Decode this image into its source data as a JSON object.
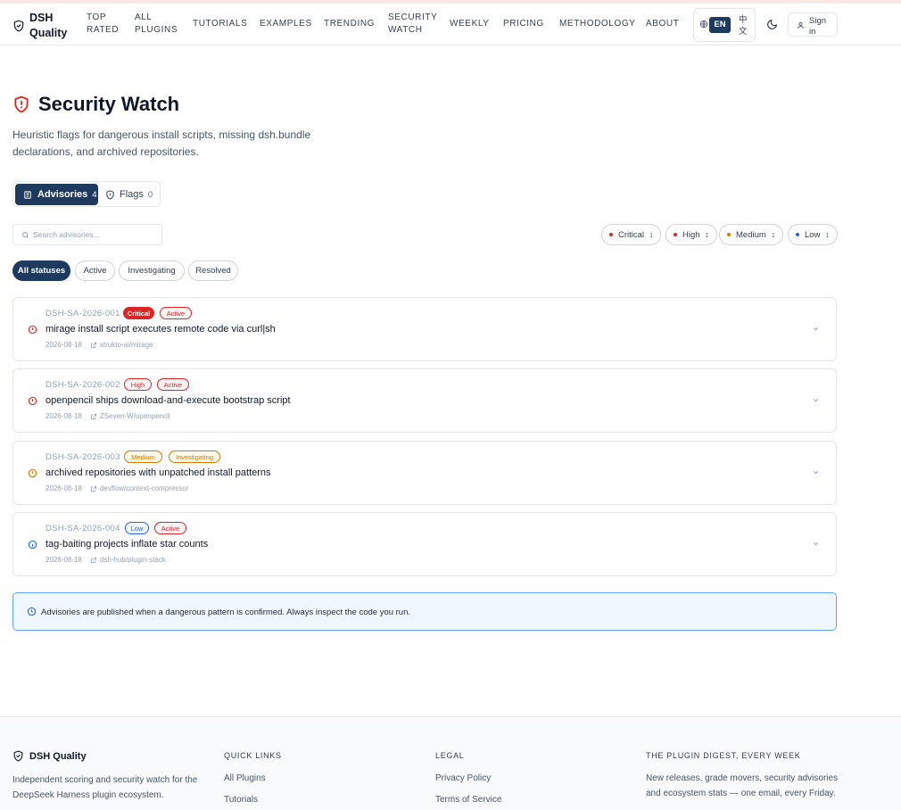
{
  "header": {
    "brand": "DSH Quality",
    "nav": [
      "TOP RATED",
      "ALL PLUGINS",
      "TUTORIALS",
      "EXAMPLES",
      "TRENDING",
      "SECURITY WATCH",
      "WEEKLY",
      "PRICING",
      "METHODOLOGY",
      "ABOUT"
    ],
    "lang_en": "EN",
    "lang_zh": "中文",
    "signin": "Sign in"
  },
  "page": {
    "title": "Security Watch",
    "subtitle": "Heuristic flags for dangerous install scripts, missing dsh.bundle declarations, and archived repositories."
  },
  "tabs": {
    "advisories_label": "Advisories",
    "advisories_count": "4",
    "flags_label": "Flags",
    "flags_count": "0"
  },
  "search": {
    "placeholder": "Search advisories..."
  },
  "severity_filters": [
    {
      "label": "Critical",
      "count": "1",
      "color": "#dc2626"
    },
    {
      "label": "High",
      "count": "1",
      "color": "#dc2626"
    },
    {
      "label": "Medium",
      "count": "1",
      "color": "#d97706"
    },
    {
      "label": "Low",
      "count": "1",
      "color": "#2563eb"
    }
  ],
  "status_filters": [
    "All statuses",
    "Active",
    "Investigating",
    "Resolved"
  ],
  "advisories": [
    {
      "id": "DSH-SA-2026-001",
      "severity": "Critical",
      "status": "Active",
      "title": "mirage install script executes remote code via curl|sh",
      "date": "2026-08-18",
      "repo": "strukto-ai/mirage"
    },
    {
      "id": "DSH-SA-2026-002",
      "severity": "High",
      "status": "Active",
      "title": "openpencil ships download-and-execute bootstrap script",
      "date": "2026-08-18",
      "repo": "ZSeven-W/openpencil"
    },
    {
      "id": "DSH-SA-2026-003",
      "severity": "Medium",
      "status": "Investigating",
      "title": "archived repositories with unpatched install patterns",
      "date": "2026-08-18",
      "repo": "devflow/context-compressor"
    },
    {
      "id": "DSH-SA-2026-004",
      "severity": "Low",
      "status": "Active",
      "title": "tag-baiting projects inflate star counts",
      "date": "2026-08-18",
      "repo": "dsh-hub/plugin-stack"
    }
  ],
  "notice": "Advisories are published when a dangerous pattern is confirmed. Always inspect the code you run.",
  "footer": {
    "brand": "DSH Quality",
    "desc": "Independent scoring and security watch for the DeepSeek Harness plugin ecosystem.",
    "quick_links_title": "QUICK LINKS",
    "quick_links": [
      "All Plugins",
      "Tutorials"
    ],
    "legal_title": "LEGAL",
    "legal": [
      "Privacy Policy",
      "Terms of Service"
    ],
    "digest_title": "THE PLUGIN DIGEST, EVERY WEEK",
    "digest_text": "New releases, grade movers, security advisories and ecosystem stats — one email, every Friday."
  },
  "colors": {
    "primary": "#1e3a5f",
    "critical": "#dc2626",
    "medium": "#d97706",
    "low": "#2563eb"
  }
}
